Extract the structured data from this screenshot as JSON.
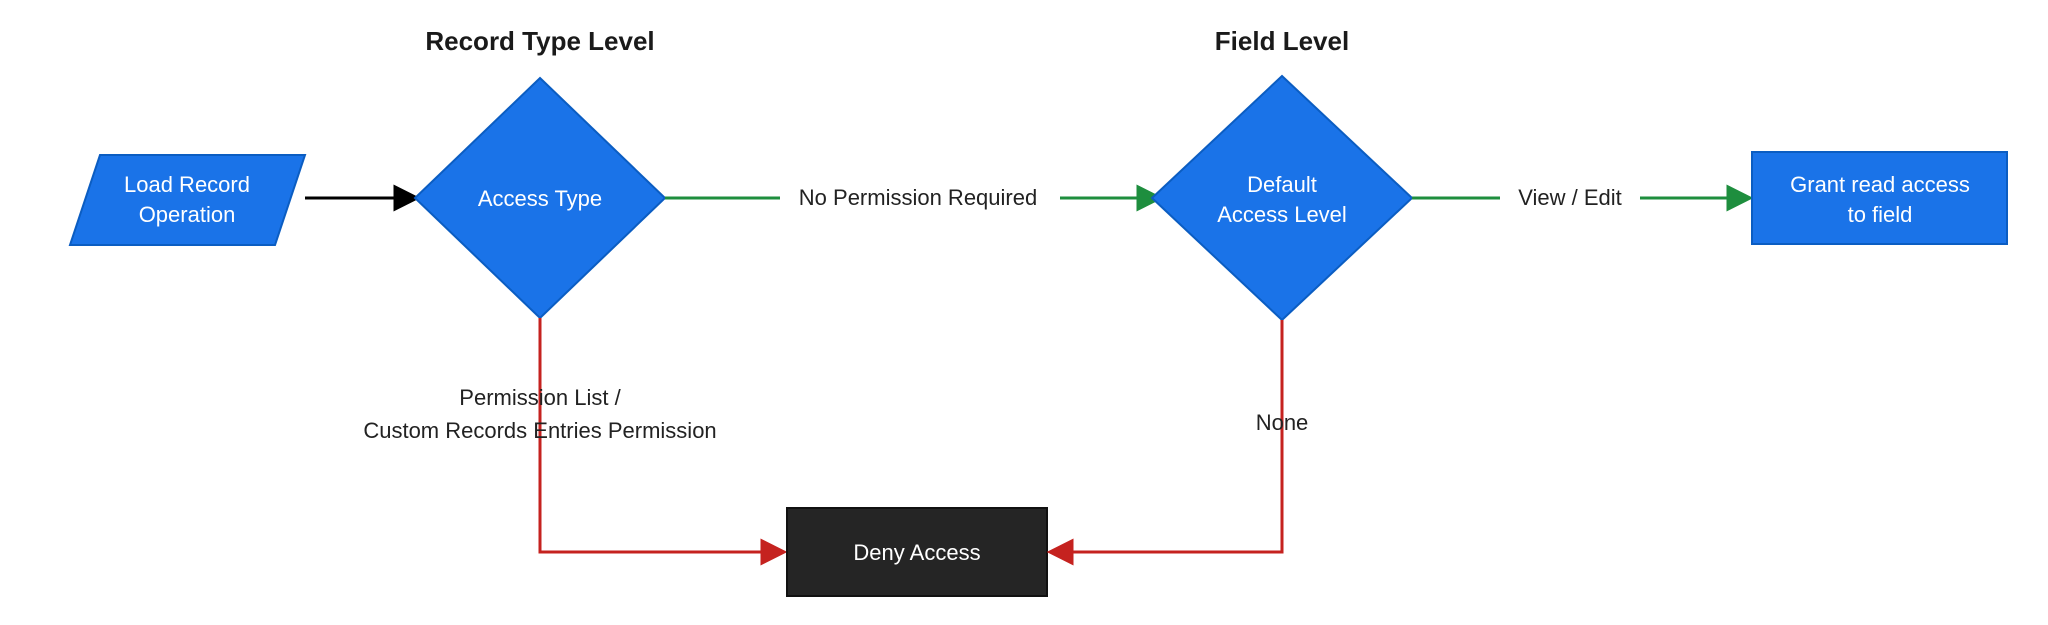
{
  "headings": {
    "record_type_level": "Record Type Level",
    "field_level": "Field Level"
  },
  "nodes": {
    "load_record": "Load Record Operation",
    "access_type": "Access Type",
    "default_access_level_l1": "Default",
    "default_access_level_l2": "Access Level",
    "deny_access": "Deny Access",
    "grant_read_l1": "Grant read access",
    "grant_read_l2": "to field"
  },
  "edges": {
    "no_permission_required": "No Permission Required",
    "view_edit": "View / Edit",
    "permission_list_l1": "Permission List /",
    "permission_list_l2": "Custom Records Entries Permission",
    "none": "None"
  },
  "colors": {
    "blue": "#1a73e8",
    "black_node": "#252525",
    "green": "#1e8e3e",
    "red": "#c5221f",
    "arrow_black": "#000000"
  }
}
